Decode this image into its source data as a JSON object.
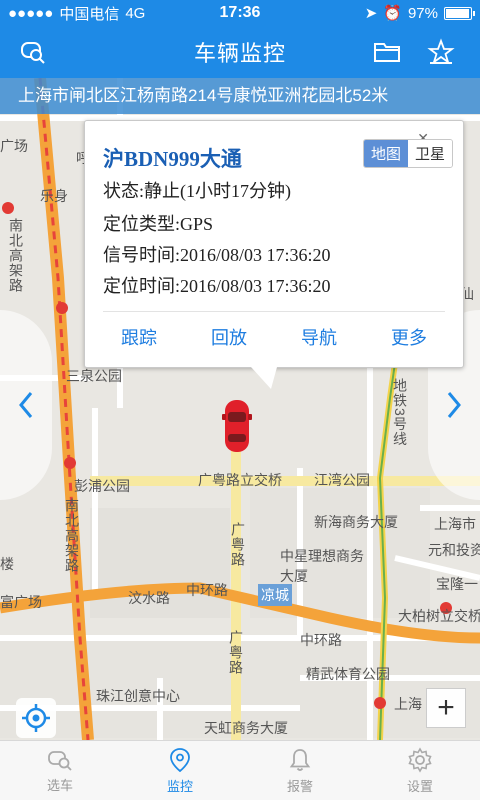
{
  "status_bar": {
    "carrier": "中国电信",
    "network": "4G",
    "time": "17:36",
    "battery": "97%",
    "battery_level": 0.97
  },
  "nav": {
    "title": "车辆监控"
  },
  "address": "上海市闸北区江杨南路214号康悦亚洲花园北52米",
  "popup": {
    "plate": "沪BDN999大通",
    "status": "状态:静止(1小时17分钟)",
    "locate_type": "定位类型:GPS",
    "signal_time": "信号时间:2016/08/03 17:36:20",
    "locate_time": "定位时间:2016/08/03 17:36:20",
    "map_toggle": {
      "map": "地图",
      "satellite": "卫星",
      "selected": "地图"
    },
    "actions": [
      "跟踪",
      "回放",
      "导航",
      "更多"
    ]
  },
  "map_labels": {
    "l1": "广场",
    "l2": "呼玛路",
    "l3": "乐身",
    "l4": "南北高架路",
    "l5": "三泉公园",
    "l6": "彭浦公园",
    "l7": "广粤路立交桥",
    "l8": "江湾公园",
    "l9": "新海商务大厦",
    "l10": "上海市",
    "l11": "元和投资",
    "l12": "中星理想商务大厦",
    "l13": "凉城",
    "l14": "宝隆一",
    "l15": "汶水路",
    "l16": "中环路",
    "l17": "大柏树立交桥",
    "l18": "中环路",
    "l19": "精武体育公园",
    "l20": "珠江创意中心",
    "l21": "天虹商务大厦",
    "l22": "上海",
    "l23": "地铁3号线",
    "l24": "广粤路",
    "l25": "南北高架路",
    "l26": "逸仙",
    "l27": "富广场",
    "l28": "广粤路",
    "l29": "楼"
  },
  "tabs": [
    {
      "label": "选车",
      "icon": "car-select-icon"
    },
    {
      "label": "监控",
      "icon": "location-pin-icon"
    },
    {
      "label": "报警",
      "icon": "bell-icon"
    },
    {
      "label": "设置",
      "icon": "gear-icon"
    }
  ],
  "active_tab": "监控",
  "colors": {
    "primary": "#1e8ae6",
    "link": "#1e7de0",
    "plate": "#1a5fb4",
    "car": "#e0202a",
    "highway": "#f4a33a"
  }
}
